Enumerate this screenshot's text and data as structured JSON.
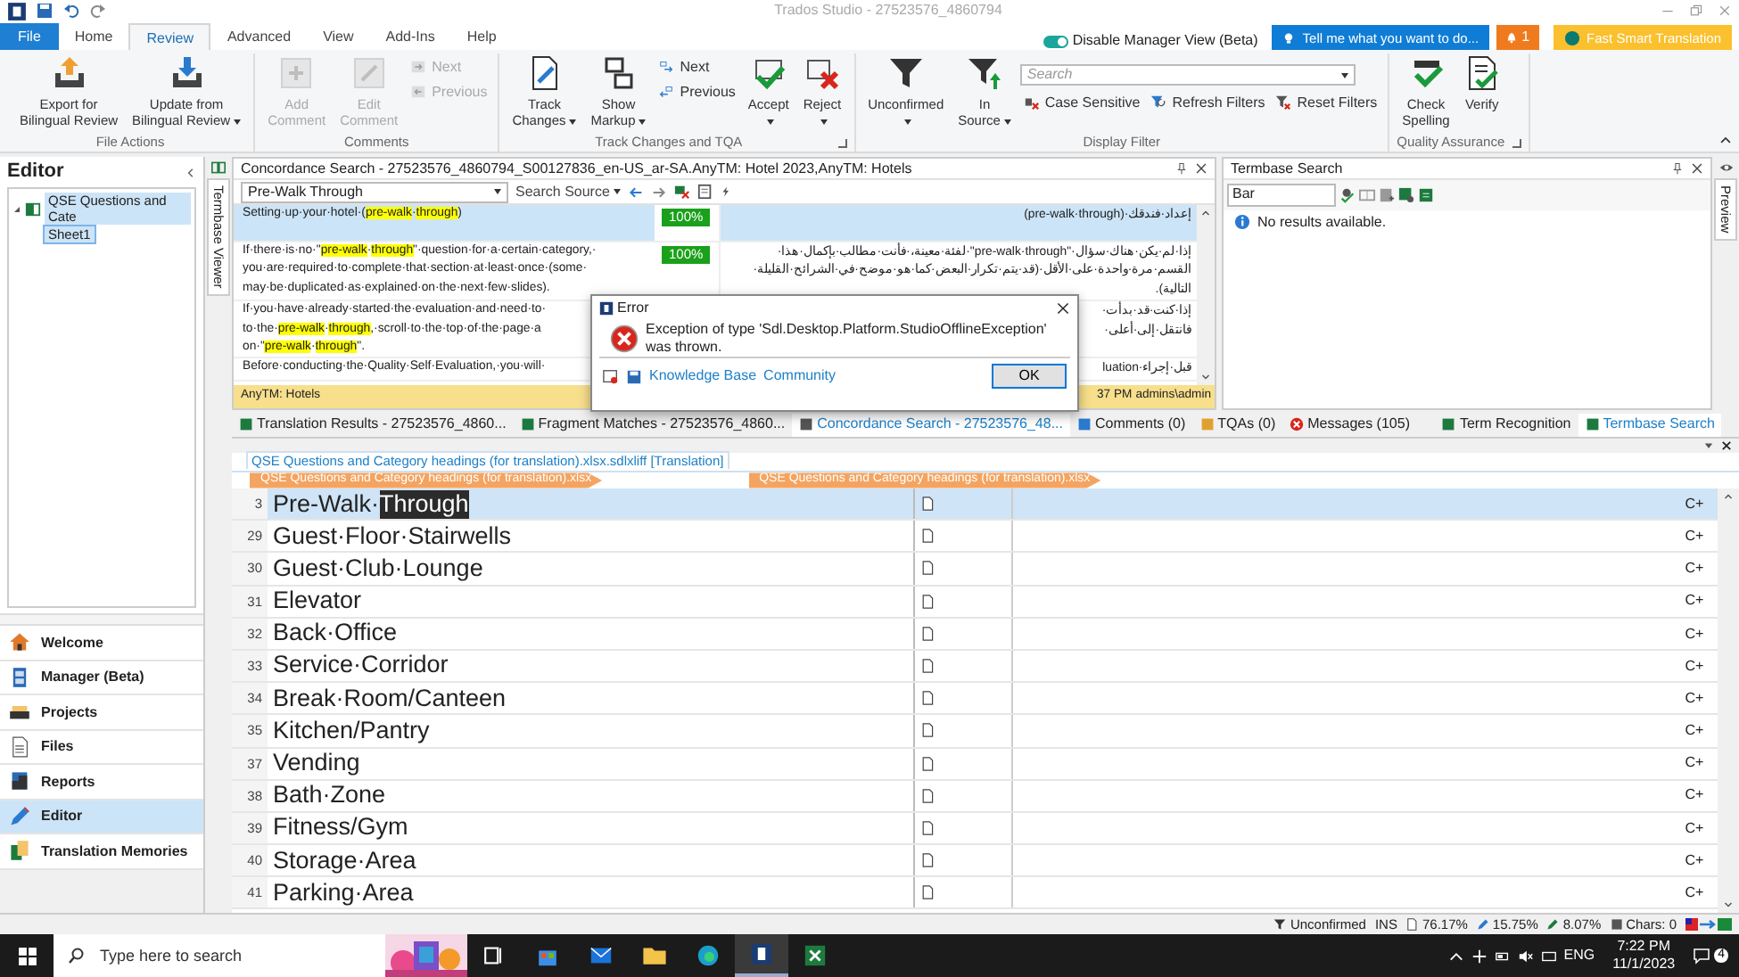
{
  "title_bar": {
    "title": "Trados Studio - 27523576_4860794"
  },
  "menu_tabs": [
    {
      "label": "File",
      "kind": "file",
      "selected": false
    },
    {
      "label": "Home",
      "kind": "tab",
      "selected": false
    },
    {
      "label": "Review",
      "kind": "tab",
      "selected": true
    },
    {
      "label": "Advanced",
      "kind": "tab",
      "selected": false
    },
    {
      "label": "View",
      "kind": "tab",
      "selected": false
    },
    {
      "label": "Add-Ins",
      "kind": "tab",
      "selected": false
    },
    {
      "label": "Help",
      "kind": "tab",
      "selected": false
    }
  ],
  "header_right": {
    "toggle": {
      "label": "Disable Manager View (Beta)",
      "on": true
    },
    "tell_me": "Tell me what you want to do...",
    "notifications": "1",
    "smart_translation": "Fast Smart Translation"
  },
  "ribbon": {
    "groups": [
      {
        "title": "File Actions",
        "launcher": false,
        "items": [
          {
            "kind": "large",
            "label": "Export for Bilingual Review",
            "disabled": false,
            "dropdown": false
          },
          {
            "kind": "large",
            "label": "Update from Bilingual Review",
            "disabled": false,
            "dropdown": true
          }
        ]
      },
      {
        "title": "Comments",
        "launcher": false,
        "items": [
          {
            "kind": "large",
            "label": "Add Comment",
            "disabled": true,
            "dropdown": false
          },
          {
            "kind": "large",
            "label": "Edit Comment",
            "disabled": true,
            "dropdown": false
          },
          {
            "kind": "small",
            "label": "Next",
            "disabled": true,
            "dropdown": false
          },
          {
            "kind": "small",
            "label": "Previous",
            "disabled": true,
            "dropdown": false
          }
        ]
      },
      {
        "title": "Track Changes and TQA",
        "launcher": true,
        "items": [
          {
            "kind": "large",
            "label": "Track Changes",
            "disabled": false,
            "dropdown": true
          },
          {
            "kind": "large",
            "label": "Show Markup",
            "disabled": false,
            "dropdown": true
          },
          {
            "kind": "small",
            "label": "Next",
            "disabled": false,
            "dropdown": false
          },
          {
            "kind": "small",
            "label": "Previous",
            "disabled": false,
            "dropdown": false
          },
          {
            "kind": "large",
            "label": "Accept",
            "disabled": false,
            "dropdown": true
          },
          {
            "kind": "large",
            "label": "Reject",
            "disabled": false,
            "dropdown": true
          }
        ]
      },
      {
        "title": "Display Filter",
        "launcher": false,
        "items": [
          {
            "kind": "large",
            "label": "Unconfirmed",
            "disabled": false,
            "dropdown": true
          },
          {
            "kind": "large",
            "label": "In Source",
            "disabled": false,
            "dropdown": true
          },
          {
            "kind": "filterbar",
            "placeholder": "Search",
            "options": [
              {
                "label": "Case Sensitive"
              },
              {
                "label": "Refresh Filters"
              },
              {
                "label": "Reset Filters"
              }
            ]
          }
        ]
      },
      {
        "title": "Quality Assurance",
        "launcher": true,
        "items": [
          {
            "kind": "large",
            "label": "Check Spelling",
            "disabled": false,
            "dropdown": false
          },
          {
            "kind": "large",
            "label": "Verify",
            "disabled": false,
            "dropdown": false
          }
        ]
      }
    ]
  },
  "sidebar": {
    "title": "Editor",
    "tree": [
      {
        "label": "QSE Questions and Cate",
        "selected": true,
        "expanded": true,
        "children": [
          {
            "label": "Sheet1",
            "selected": true
          }
        ]
      }
    ],
    "nav": [
      {
        "label": "Welcome",
        "selected": false
      },
      {
        "label": "Manager (Beta)",
        "selected": false
      },
      {
        "label": "Projects",
        "selected": false
      },
      {
        "label": "Files",
        "selected": false
      },
      {
        "label": "Reports",
        "selected": false
      },
      {
        "label": "Editor",
        "selected": true
      },
      {
        "label": "Translation Memories",
        "selected": false
      }
    ]
  },
  "side_tabs": {
    "left": "Termbase Viewer",
    "right": "Preview"
  },
  "concordance": {
    "title": "Concordance Search - 27523576_4860794_S00127836_en-US_ar-SA.AnyTM: Hotel 2023,AnyTM: Hotels",
    "query": "Pre-Walk Through",
    "mode": "Search Source",
    "rows": [
      {
        "selected": true,
        "score": "100%",
        "source": [
          "Setting·up·your·hotel·(**pre-walk**·**through**)"
        ],
        "target": [
          "إعداد·فندقك·(pre-walk·through)"
        ]
      },
      {
        "selected": false,
        "score": "100%",
        "source": [
          "If·there·is·no·\"**pre-walk**·**through**\"·question·for·a·certain·category,·",
          "you·are·required·to·complete·that·section·at·least·once·(some·",
          "may·be·duplicated·as·explained·on·the·next·few·slides)."
        ],
        "target": [
          "إذا·لم·يكن·هناك·سؤال·\"pre-walk·through\"·لفئة·معينة،·فأنت·مطالب·بإكمال·هذا·",
          "القسم·مرة·واحدة·على·الأقل·(قد·يتم·تكرار·البعض·كما·هو·موضح·في·الشرائح·القليلة·",
          "التالية)."
        ]
      },
      {
        "selected": false,
        "source": [
          "If·you·have·already·started·the·evaluation·and·need·to·",
          "to·the·**pre-walk**·**through**,·scroll·to·the·top·of·the·page·a",
          "on·\"**pre-walk**·**through**\"."
        ],
        "target": [
          "إذا·كنت·قد·بدأت·",
          "فانتقل·إلى·أعلى·"
        ]
      },
      {
        "selected": false,
        "source": [
          "Before·conducting·the·Quality·Self·Evaluation,·you·will·"
        ],
        "target": [
          "قبل·إجراء·luation"
        ]
      }
    ],
    "status": {
      "tm": "AnyTM: Hotels",
      "time": "37 PM",
      "user": "admins\\admin"
    }
  },
  "termbase": {
    "title": "Termbase Search",
    "query": "Bar",
    "message": "No results available."
  },
  "pane_tabs": [
    {
      "label": "Translation Results - 27523576_4860...",
      "selected": false
    },
    {
      "label": "Fragment Matches - 27523576_4860...",
      "selected": false
    },
    {
      "label": "Concordance Search - 27523576_48...",
      "selected": true
    },
    {
      "label": "Comments (0)",
      "selected": false
    },
    {
      "label": "TQAs (0)",
      "selected": false
    },
    {
      "label": "Messages (105)",
      "selected": false
    }
  ],
  "right_tabs": [
    {
      "label": "Term Recognition",
      "selected": false
    },
    {
      "label": "Termbase Search",
      "selected": true
    }
  ],
  "editor": {
    "document": "QSE Questions and Category headings (for translation).xlsx.sdlxliff [Translation]",
    "source_file_tag": "QSE Questions and Category headings (for translation).xlsx",
    "target_file_tag": "QSE Questions and Category headings (for translation).xlsx",
    "rows": [
      {
        "number": "3",
        "source": "Pre-Walk·**Through**",
        "status": "C+",
        "selected": true
      },
      {
        "number": "29",
        "source": "Guest·Floor·Stairwells",
        "status": "C+",
        "selected": false
      },
      {
        "number": "30",
        "source": "Guest·Club·Lounge",
        "status": "C+",
        "selected": false
      },
      {
        "number": "31",
        "source": "Elevator",
        "status": "C+",
        "selected": false
      },
      {
        "number": "32",
        "source": "Back·Office",
        "status": "C+",
        "selected": false
      },
      {
        "number": "33",
        "source": "Service·Corridor",
        "status": "C+",
        "selected": false
      },
      {
        "number": "34",
        "source": "Break·Room/Canteen",
        "status": "C+",
        "selected": false
      },
      {
        "number": "35",
        "source": "Kitchen/Pantry",
        "status": "C+",
        "selected": false
      },
      {
        "number": "37",
        "source": "Vending",
        "status": "C+",
        "selected": false
      },
      {
        "number": "38",
        "source": "Bath·Zone",
        "status": "C+",
        "selected": false
      },
      {
        "number": "39",
        "source": "Fitness/Gym",
        "status": "C+",
        "selected": false
      },
      {
        "number": "40",
        "source": "Storage·Area",
        "status": "C+",
        "selected": false
      },
      {
        "number": "41",
        "source": "Parking·Area",
        "status": "C+",
        "selected": false
      }
    ]
  },
  "dialog": {
    "title": "Error",
    "message": "Exception of type 'Sdl.Desktop.Platform.StudioOfflineException' was thrown.",
    "links": [
      "Knowledge Base",
      "Community"
    ],
    "button": "OK"
  },
  "status_bar": {
    "filter": "Unconfirmed",
    "mode": "INS",
    "stats": [
      "76.17%",
      "15.75%",
      "8.07%"
    ],
    "chars": "Chars: 0"
  },
  "taskbar": {
    "search_placeholder": "Type here to search",
    "language": "ENG",
    "time": "7:22 PM",
    "date": "11/1/2023",
    "notifications": "4"
  }
}
